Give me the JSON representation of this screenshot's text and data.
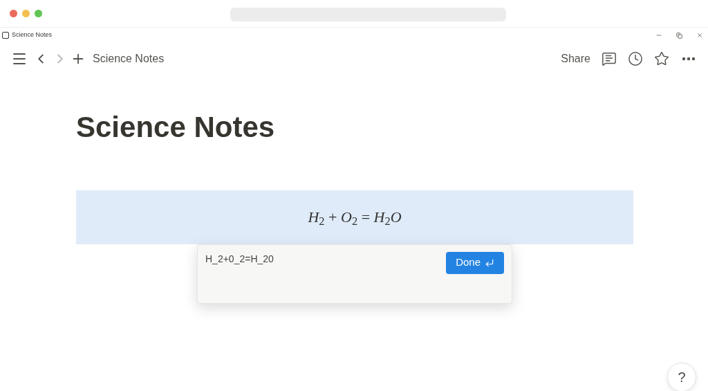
{
  "window": {
    "title": "Science Notes"
  },
  "toolbar": {
    "breadcrumb": "Science Notes",
    "share": "Share",
    "favorite": false
  },
  "page": {
    "title": "Science Notes",
    "equation": {
      "rendered": "*H*$_{2}$ + *O*$_{2}$ = *H*$_{2}$*O*",
      "selected": true
    },
    "equation_editor": {
      "value": "H_2+0_2=H_20",
      "done": "Done"
    }
  },
  "help": "?"
}
